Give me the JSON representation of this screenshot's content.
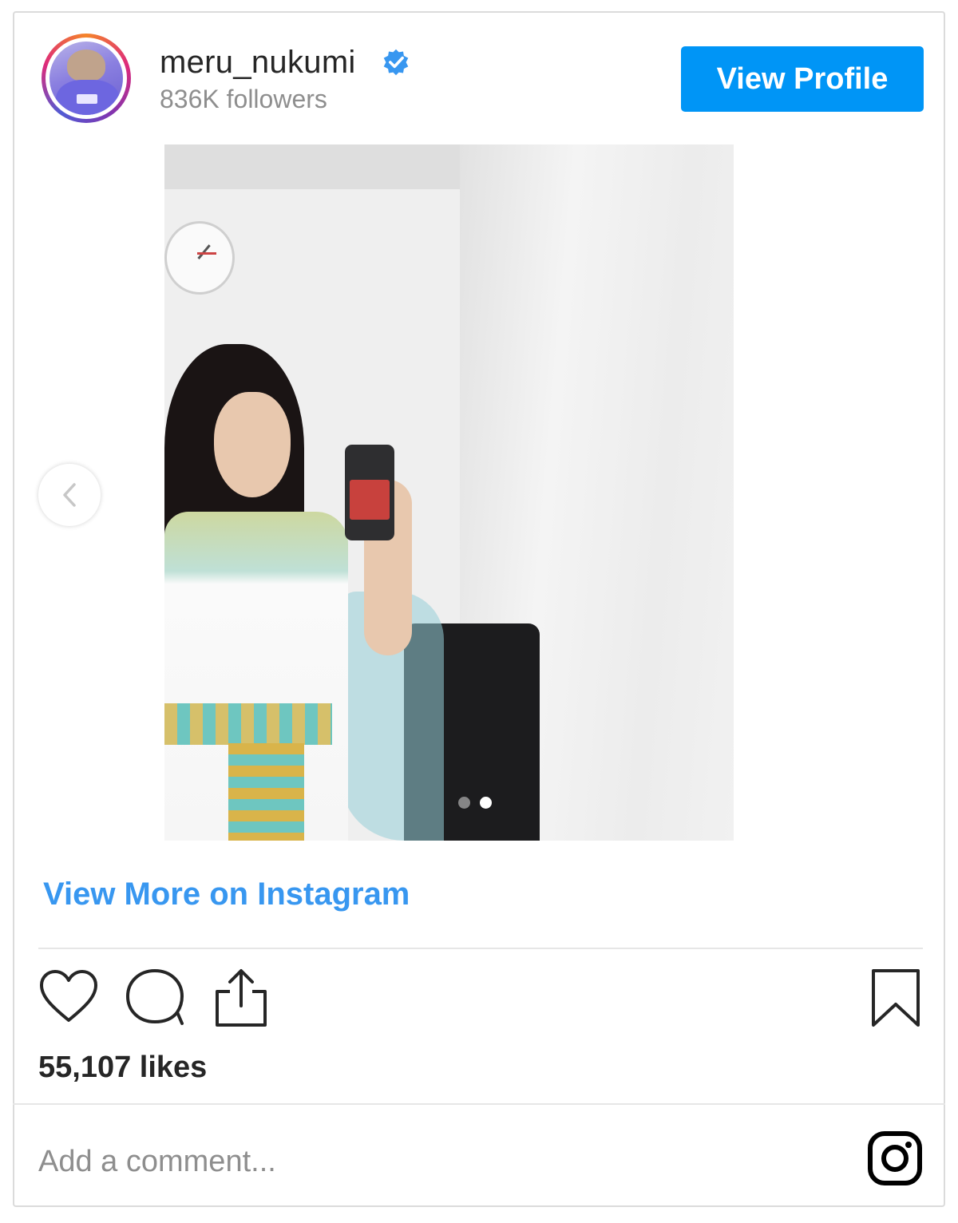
{
  "header": {
    "username": "meru_nukumi",
    "followers": "836K followers",
    "view_profile_label": "View Profile",
    "verified_icon": "verified-badge-icon"
  },
  "post": {
    "carousel": {
      "total_slides": 2,
      "active_slide": 2
    },
    "view_more_label": "View More on Instagram"
  },
  "actions": {
    "icons": [
      "heart-icon",
      "comment-icon",
      "share-icon",
      "bookmark-icon"
    ],
    "likes": "55,107 likes"
  },
  "comment": {
    "placeholder": "Add a comment...",
    "logo_icon": "instagram-logo-icon"
  },
  "colors": {
    "accent": "#0095f6",
    "link": "#3897f0",
    "verified": "#3897f0",
    "text": "#262626",
    "muted": "#8e8e8e"
  }
}
